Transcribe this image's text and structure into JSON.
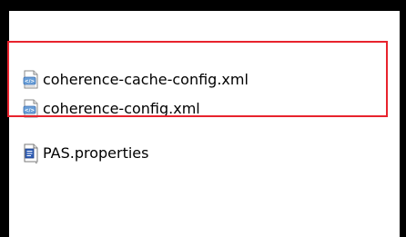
{
  "files": [
    {
      "name": "coherence-cache-config.xml",
      "icon": "xml-file-icon"
    },
    {
      "name": "coherence-config.xml",
      "icon": "xml-file-icon"
    },
    {
      "name": "PAS.properties",
      "icon": "properties-file-icon"
    }
  ],
  "colors": {
    "highlight": "#e8232d",
    "frame": "#000000",
    "background": "#ffffff"
  }
}
